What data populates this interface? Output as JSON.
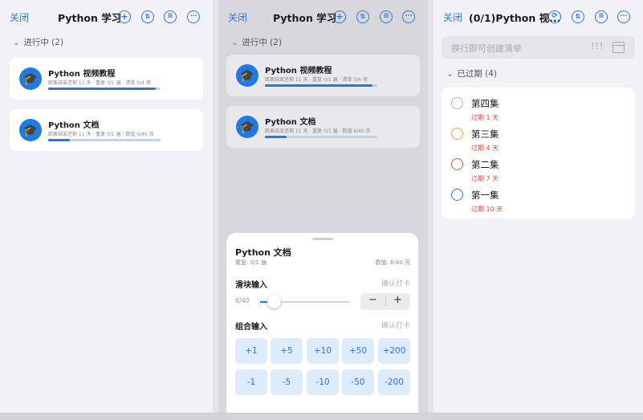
{
  "left_pane": {
    "close": "关闭",
    "title": "Python 学习",
    "icons": [
      "plus-icon",
      "sort-icon",
      "list-icon",
      "more-icon"
    ],
    "section": "进行中 (2)",
    "cards": [
      {
        "name": "Python 视频教程",
        "meta": "距离结束还剩 11 天 · 重复 0/1 遍 · 清单 0/4 项",
        "progress": 0.96
      },
      {
        "name": "Python 文档",
        "meta": "距离结束还剩 11 天 · 重复 0/1 遍 · 数值 6/40 页",
        "progress": 0.19
      }
    ]
  },
  "middle_pane": {
    "close": "关闭",
    "title": "Python 学习",
    "section": "进行中 (2)",
    "cards": [
      {
        "name": "Python 视频教程",
        "meta": "距离结束还剩 11 天 · 重复 0/1 遍 · 清单 0/4 项",
        "progress": 0.96
      },
      {
        "name": "Python 文档",
        "meta": "距离结束还剩 11 天 · 重复 0/1 遍 · 数值 6/40 页",
        "progress": 0.19
      }
    ],
    "sheet": {
      "title": "Python 文档",
      "repeat": "重复: 0/1 遍",
      "count": "数值: 6/40 页",
      "slider_label": "滑块输入",
      "slider_confirm": "确认打卡",
      "slider_value": "6/40",
      "slider_fraction": 0.15,
      "minus": "−",
      "plus": "+",
      "combo_label": "组合输入",
      "combo_confirm": "确认打卡",
      "buttons_row1": [
        "+1",
        "+5",
        "+10",
        "+50",
        "+200"
      ],
      "buttons_row2": [
        "-1",
        "-5",
        "-10",
        "-50",
        "-200"
      ]
    }
  },
  "right_pane": {
    "close": "关闭",
    "title": "(0/1)Python 视...",
    "input_placeholder": "换行即可创建清单",
    "priority": "!!!",
    "section": "已过期 (4)",
    "todos": [
      {
        "name": "第四集",
        "overdue": "过期 1 天",
        "color": "#b0b0b5"
      },
      {
        "name": "第三集",
        "overdue": "过期 4 天",
        "color": "#e8a33a"
      },
      {
        "name": "第二集",
        "overdue": "过期 7 天",
        "color": "#d9534f"
      },
      {
        "name": "第一集",
        "overdue": "过期 10 天",
        "color": "#2b77e3"
      }
    ]
  }
}
